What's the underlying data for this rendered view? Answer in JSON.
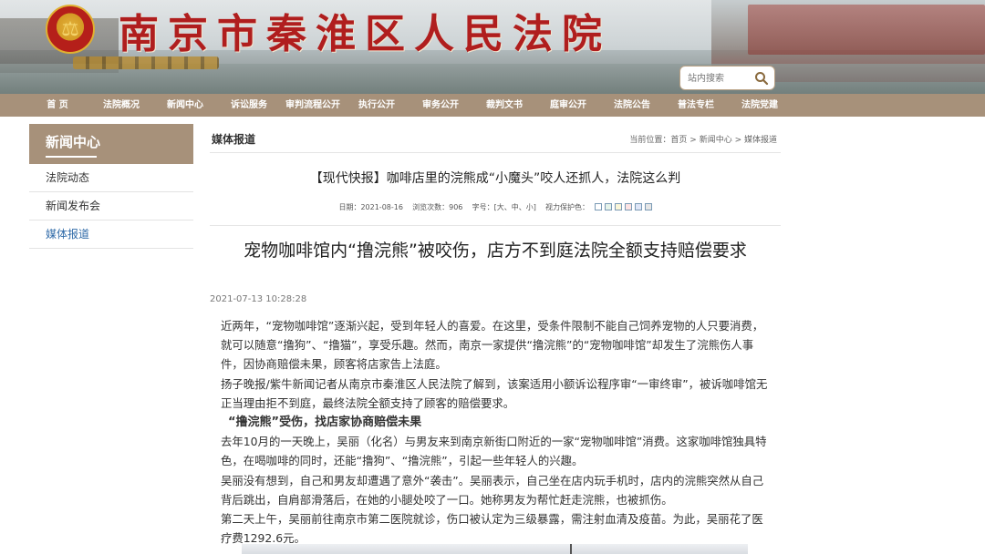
{
  "site": {
    "title": "南京市秦淮区人民法院",
    "emblem_glyph": "⚖",
    "search_placeholder": "站内搜索"
  },
  "nav": {
    "items": [
      "首 页",
      "法院概况",
      "新闻中心",
      "诉讼服务",
      "审判流程公开",
      "执行公开",
      "审务公开",
      "裁判文书",
      "庭审公开",
      "法院公告",
      "普法专栏",
      "法院党建"
    ]
  },
  "sidebar": {
    "heading": "新闻中心",
    "items": [
      {
        "label": "法院动态",
        "active": false
      },
      {
        "label": "新闻发布会",
        "active": false
      },
      {
        "label": "媒体报道",
        "active": true
      }
    ]
  },
  "main": {
    "section_label": "媒体报道",
    "breadcrumb": {
      "prefix": "当前位置：",
      "home": "首页",
      "sep1": " > ",
      "level1": "新闻中心",
      "sep2": " > ",
      "level2": "媒体报道"
    },
    "article_title": "【现代快报】咖啡店里的浣熊成“小魔头”咬人还抓人，法院这么判",
    "meta": {
      "date": "日期：2021-08-16",
      "views": "浏览次数：906",
      "font_prefix": "字号：[",
      "font_large": "大",
      "font_medium": "中",
      "font_small": "小",
      "font_suffix": "]",
      "eye_care": "视力保护色："
    },
    "eye_colors": [
      "#ffffff",
      "#e6f3ea",
      "#fbf6d8",
      "#fde3e3",
      "#dfe6f7",
      "#e6e6e6"
    ],
    "headline": "宠物咖啡馆内“撸浣熊”被咬伤，店方不到庭法院全额支持赔偿要求",
    "publish_time": "2021-07-13 10:28:28",
    "paragraphs": {
      "p1": "近两年，“宠物咖啡馆”逐渐兴起，受到年轻人的喜爱。在这里，受条件限制不能自己饲养宠物的人只要消费，就可以随意“撸狗”、“撸猫”，享受乐趣。然而，南京一家提供“撸浣熊”的“宠物咖啡馆”却发生了浣熊伤人事件，因协商赔偿未果，顾客将店家告上法庭。",
      "p2": "扬子晚报/紫牛新闻记者从南京市秦淮区人民法院了解到，该案适用小额诉讼程序审“一审终审”，被诉咖啡馆无正当理由拒不到庭，最终法院全额支持了顾客的赔偿要求。",
      "sub1": "“撸浣熊”受伤，找店家协商赔偿未果",
      "p3": "去年10月的一天晚上，吴丽（化名）与男友来到南京新街口附近的一家“宠物咖啡馆”消费。这家咖啡馆独具特色，在喝咖啡的同时，还能“撸狗”、“撸浣熊”，引起一些年轻人的兴趣。",
      "p4": "吴丽没有想到，自己和男友却遭遇了意外“袭击”。吴丽表示，自己坐在店内玩手机时，店内的浣熊突然从自己背后跳出，自肩部滑落后，在她的小腿处咬了一口。她称男友为帮忙赶走浣熊，也被抓伤。",
      "p5": "第二天上午，吴丽前往南京市第二医院就诊，伤口被认定为三级暴露，需注射血清及疫苗。为此，吴丽花了医疗费1292.6元。"
    }
  }
}
